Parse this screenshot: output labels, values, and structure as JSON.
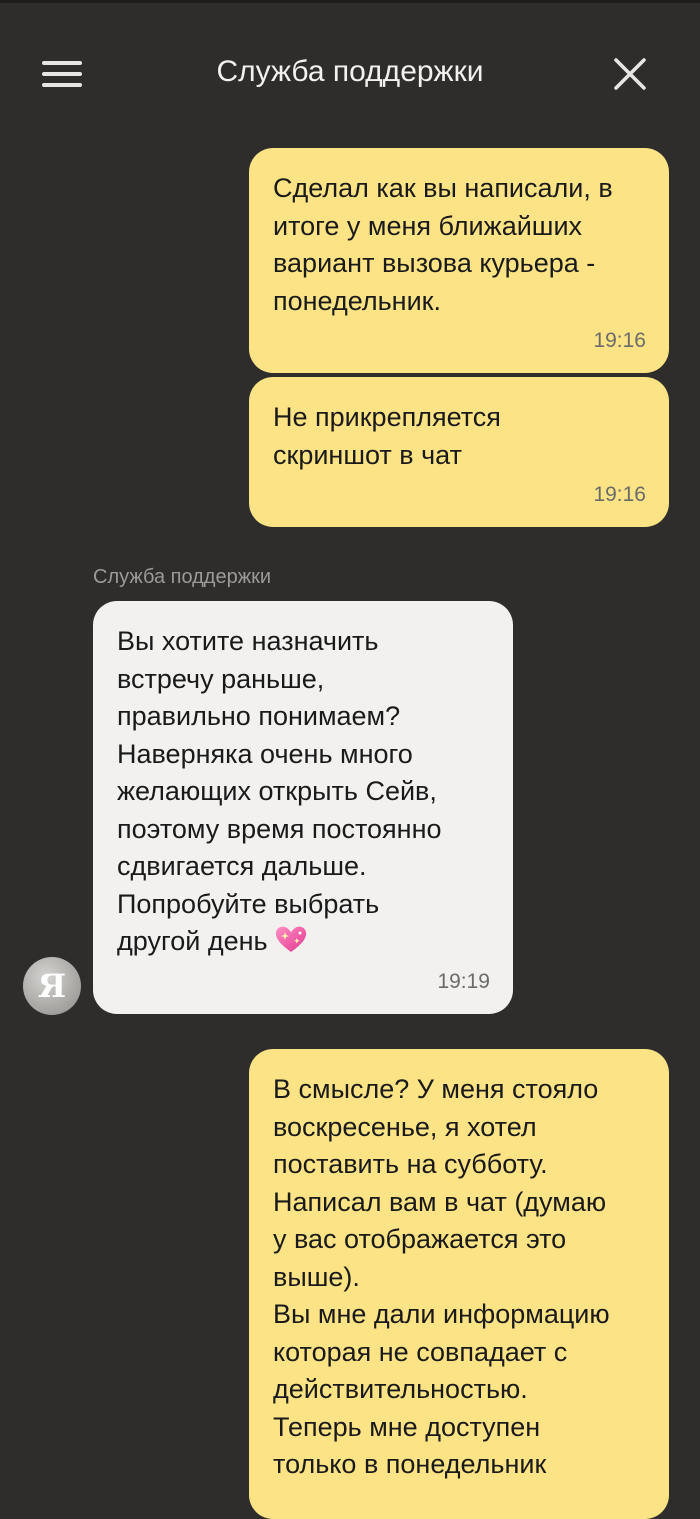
{
  "header": {
    "title": "Служба поддержки",
    "menu_icon": "hamburger-menu-icon",
    "close_icon": "close-icon"
  },
  "messages": [
    {
      "direction": "outgoing",
      "text": "Сделал как вы написали, в\nитоге у меня ближайших\nвариант вызова курьера -\nпонедельник.",
      "time": "19:16"
    },
    {
      "direction": "outgoing",
      "text": "Не прикрепляется\nскриншот в чат",
      "time": "19:16"
    },
    {
      "direction": "incoming",
      "sender": "Служба поддержки",
      "avatar_letter": "Я",
      "text": "Вы хотите назначить\nвстречу раньше,\nправильно понимаем?\nНаверняка очень много\nжелающих открыть Сейв,\nпоэтому время постоянно\nсдвигается дальше.\nПопробуйте выбрать\nдругой день",
      "emoji": "sparkling-heart-icon",
      "time": "19:19"
    },
    {
      "direction": "outgoing",
      "text": "В смысле? У меня стояло\nвоскресенье, я хотел\nпоставить на субботу.\nНаписал вам в чат (думаю\nу вас отображается это\nвыше).\nВы мне дали информацию\nкоторая не совпадает с\nдействительностью.\nТеперь мне доступен\nтолько в понедельник"
    }
  ],
  "colors": {
    "background": "#2e2d2c",
    "outgoing_bubble": "#fce385",
    "incoming_bubble": "#f2f1ef",
    "header_text": "#f2f1ef",
    "time_text": "#6b6b6b",
    "sender_label": "#9b9a98"
  }
}
